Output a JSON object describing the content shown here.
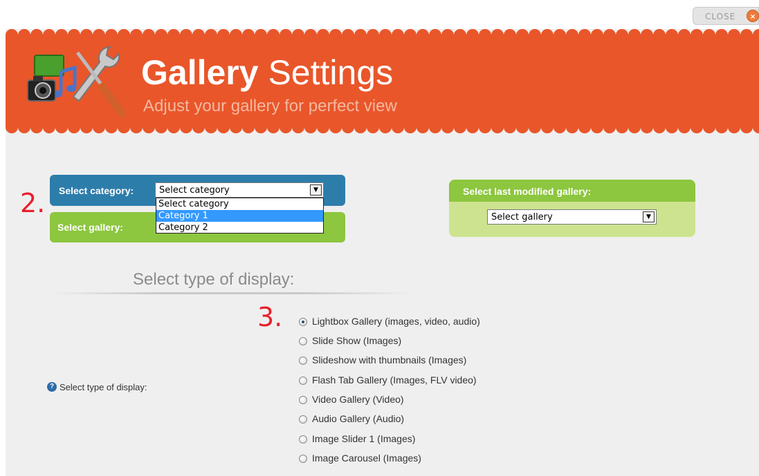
{
  "close_label": "CLOSE",
  "header": {
    "title_bold": "Gallery",
    "title_rest": " Settings",
    "subtitle": "Adjust your gallery for perfect view"
  },
  "steps": {
    "two": "2.",
    "three": "3."
  },
  "category": {
    "label": "Select category:",
    "selected": "Select category",
    "options": [
      "Select category",
      "Category 1",
      "Category 2"
    ],
    "highlighted_option": "Category 1"
  },
  "gallery": {
    "label": "Select gallery:"
  },
  "last_modified": {
    "label": "Select last modified gallery:",
    "selected": "Select gallery"
  },
  "display": {
    "section_title": "Select type of display:",
    "field_label": "Select type of display:",
    "options": [
      "Lightbox Gallery (images, video, audio)",
      "Slide Show (Images)",
      "Slideshow with thumbnails (Images)",
      "Flash Tab Gallery (Images, FLV video)",
      "Video Gallery (Video)",
      "Audio Gallery (Audio)",
      "Image Slider 1 (Images)",
      "Image Carousel (Images)"
    ],
    "selected_index": 0
  },
  "colors": {
    "header": "#e9562a",
    "blue": "#2d7dab",
    "green": "#8dc63f",
    "light_green": "#cde38f",
    "step_red": "#e8202a"
  }
}
